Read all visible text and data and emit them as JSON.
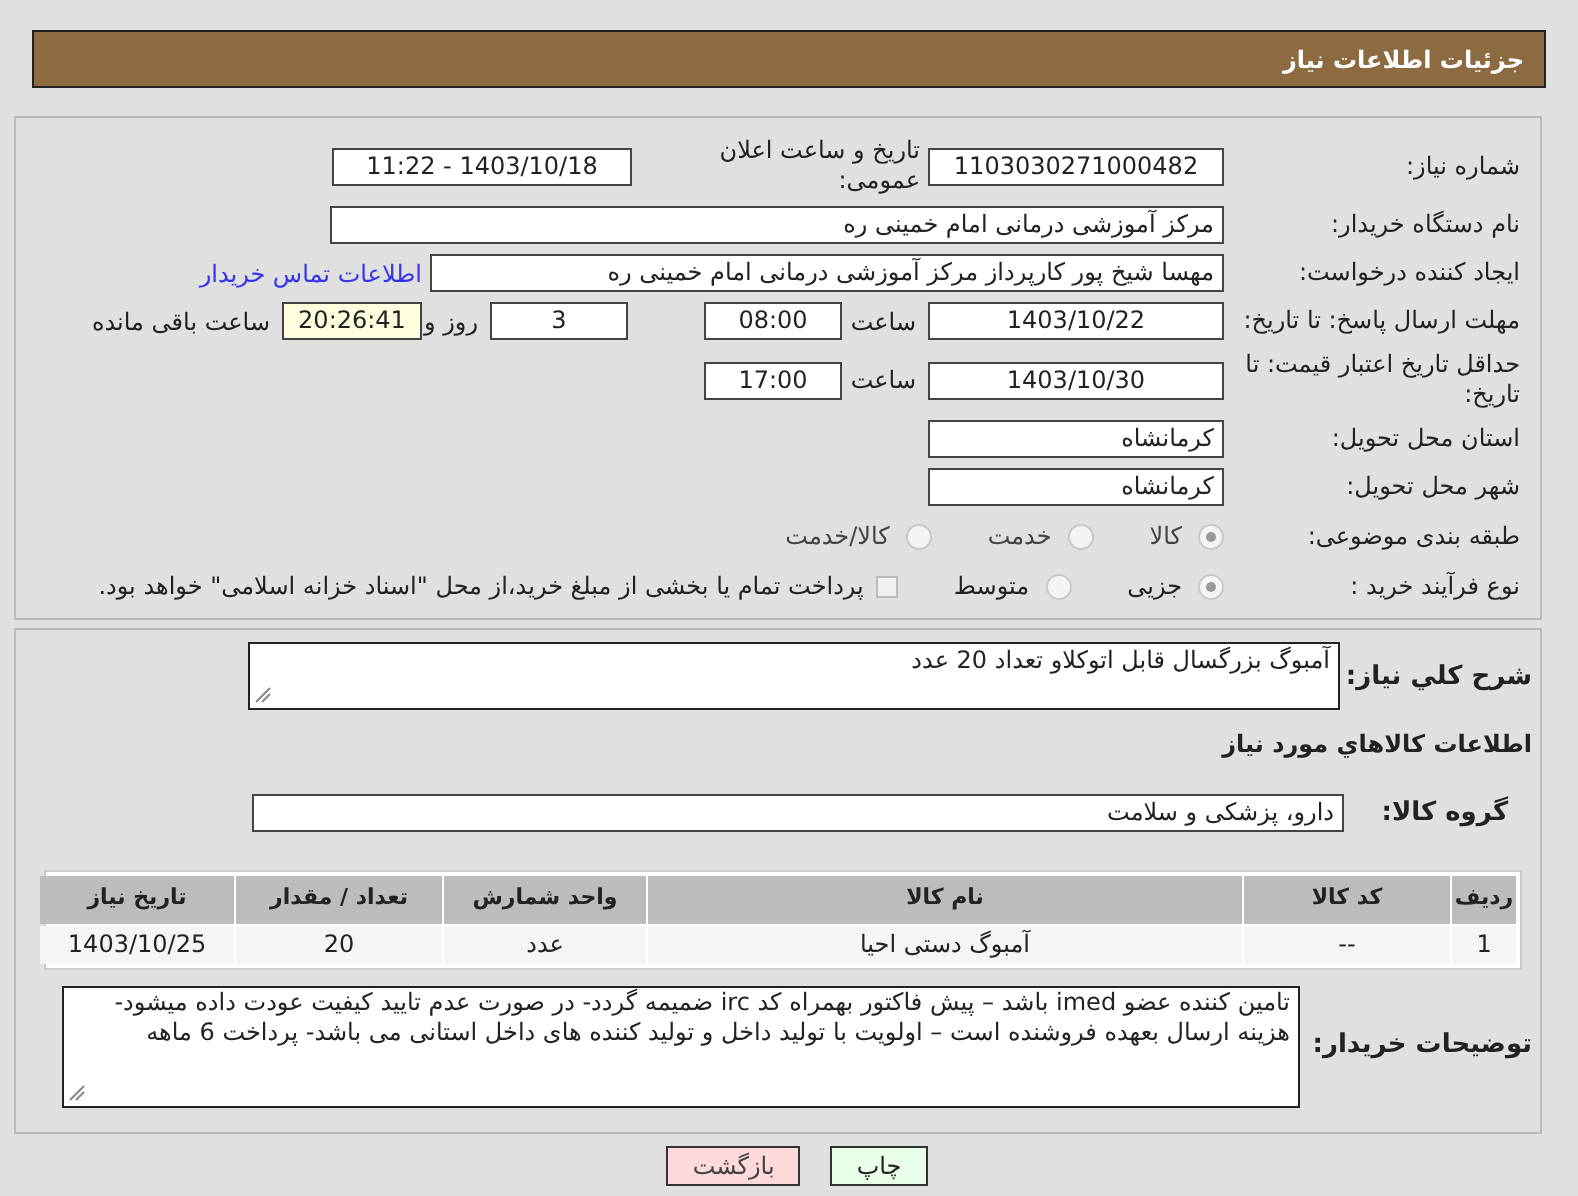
{
  "header": {
    "title": "جزئیات اطلاعات نیاز"
  },
  "need_number": {
    "label": "شماره نیاز:",
    "value": "1103030271000482"
  },
  "announce": {
    "label": "تاریخ و ساعت اعلان عمومی:",
    "value": "1403/10/18 - 11:22"
  },
  "buyer_org": {
    "label": "نام دستگاه خریدار:",
    "value": "مرکز آموزشی درمانی امام خمینی ره"
  },
  "requester": {
    "label": "ایجاد کننده درخواست:",
    "value": "مهسا شیخ پور کارپرداز مرکز آموزشی درمانی امام خمینی ره",
    "link": "اطلاعات تماس خریدار"
  },
  "reply_deadline": {
    "label": "مهلت ارسال پاسخ: تا تاریخ:",
    "date": "1403/10/22",
    "time_label": "ساعت",
    "time": "08:00",
    "days": "3",
    "days_label": "روز و",
    "remaining": "20:26:41",
    "remaining_label": "ساعت باقی مانده"
  },
  "price_validity": {
    "label": "حداقل تاریخ اعتبار قیمت: تا تاریخ:",
    "date": "1403/10/30",
    "time_label": "ساعت",
    "time": "17:00"
  },
  "province": {
    "label": "استان محل تحویل:",
    "value": "کرمانشاه"
  },
  "city": {
    "label": "شهر محل تحویل:",
    "value": "کرمانشاه"
  },
  "category": {
    "label": "طبقه بندی موضوعی:",
    "options": [
      {
        "label": "کالا",
        "selected": true
      },
      {
        "label": "خدمت",
        "selected": false
      },
      {
        "label": "کالا/خدمت",
        "selected": false
      }
    ]
  },
  "purchase_type": {
    "label": "نوع فرآیند خرید :",
    "options": [
      {
        "label": "جزیی",
        "selected": true
      },
      {
        "label": "متوسط",
        "selected": false
      }
    ],
    "payment": {
      "checked": false,
      "text": "پرداخت تمام یا بخشی از مبلغ خرید،از محل \"اسناد خزانه اسلامی\" خواهد بود."
    }
  },
  "description": {
    "label": "شرح کلي نیاز:",
    "value": "آمبوگ بزرگسال قابل اتوکلاو تعداد 20 عدد"
  },
  "items_title": "اطلاعات کالاهاي مورد نیاز",
  "goods_group": {
    "label": "گروه کالا:",
    "value": "دارو، پزشکی و سلامت"
  },
  "table": {
    "columns": [
      "ردیف",
      "کد کالا",
      "نام کالا",
      "واحد شمارش",
      "تعداد / مقدار",
      "تاریخ نیاز"
    ],
    "rows": [
      [
        "1",
        "--",
        "آمبوگ دستی احیا",
        "عدد",
        "20",
        "1403/10/25"
      ]
    ]
  },
  "buyer_notes": {
    "label": "توضیحات خریدار:",
    "value": "تامین کننده عضو imed باشد – پیش فاکتور بهمراه کد irc ضمیمه گردد- در صورت عدم تایید کیفیت عودت داده میشود- هزینه ارسال بعهده فروشنده است – اولویت با تولید داخل و تولید کننده های داخل استانی می باشد- پرداخت 6 ماهه"
  },
  "buttons": [
    {
      "label": "چاپ",
      "kind": "print"
    },
    {
      "label": "بازگشت",
      "kind": "back"
    }
  ]
}
